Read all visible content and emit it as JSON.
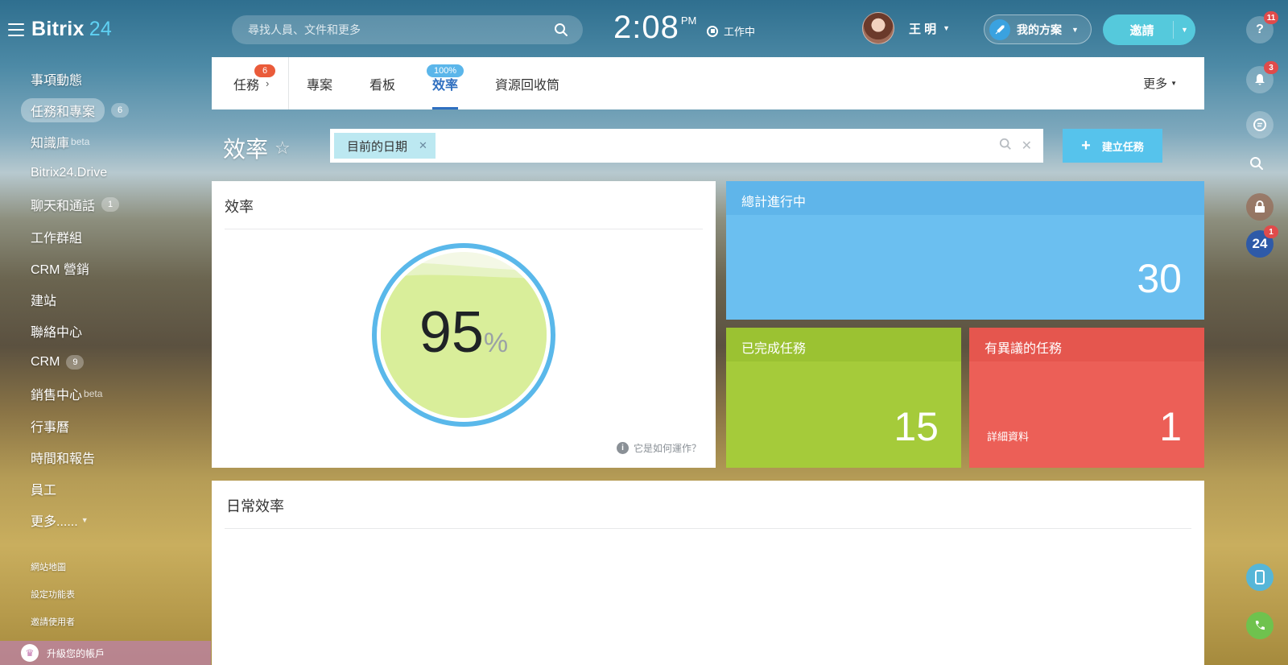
{
  "logo": {
    "brand": "Bitrix",
    "num": "24"
  },
  "sidebar": {
    "items": [
      {
        "label": "事項動態"
      },
      {
        "label": "任務和專案",
        "badge": "6",
        "active": true
      },
      {
        "label": "知識庫",
        "sup": "beta"
      },
      {
        "label": "Bitrix24.Drive"
      },
      {
        "label": "聊天和通話",
        "badge": "1"
      },
      {
        "label": "工作群組"
      },
      {
        "label": "CRM 營銷"
      },
      {
        "label": "建站"
      },
      {
        "label": "聯絡中心"
      },
      {
        "label": "CRM",
        "badge": "9"
      },
      {
        "label": "銷售中心",
        "sup": "beta"
      },
      {
        "label": "行事曆"
      },
      {
        "label": "時間和報告"
      },
      {
        "label": "員工"
      },
      {
        "label": "更多......"
      }
    ],
    "links": [
      "網站地圖",
      "設定功能表",
      "邀請使用者"
    ],
    "upgrade": "升級您的帳戶"
  },
  "topbar": {
    "search_placeholder": "尋找人員、文件和更多",
    "time": "2:08",
    "ampm": "PM",
    "work_status": "工作中",
    "user_name": "王 明",
    "plan_label": "我的方案",
    "invite_label": "邀請"
  },
  "rail": {
    "help_badge": "11",
    "notif_badge": "3",
    "b24_label": "24",
    "b24_badge": "1"
  },
  "tabs": {
    "tasks": {
      "label": "任務",
      "badge": "6"
    },
    "items": [
      {
        "label": "專案"
      },
      {
        "label": "看板"
      },
      {
        "label": "效率",
        "badge": "100%",
        "active": true
      },
      {
        "label": "資源回收筒"
      }
    ],
    "more": "更多"
  },
  "page": {
    "title": "效率",
    "filter_chip": "目前的日期",
    "create_button": "建立任務"
  },
  "efficiency": {
    "title": "效率",
    "value": "95",
    "unit": "%",
    "fill_fraction": 0.95,
    "how": "它是如何運作？"
  },
  "stats": {
    "total": {
      "label": "總計進行中",
      "value": "30"
    },
    "completed": {
      "label": "已完成任務",
      "value": "15"
    },
    "disputed": {
      "label": "有異議的任務",
      "value": "1",
      "detail": "詳細資料"
    }
  },
  "daily": {
    "title": "日常效率"
  },
  "colors": {
    "accent_blue": "#2f6fc0",
    "tile_blue": "#6bbff0",
    "tile_green": "#a5cb3a",
    "tile_red": "#ec5f57",
    "gauge_ring": "#5ab8ea",
    "gauge_fill": "#d9ee9a"
  }
}
